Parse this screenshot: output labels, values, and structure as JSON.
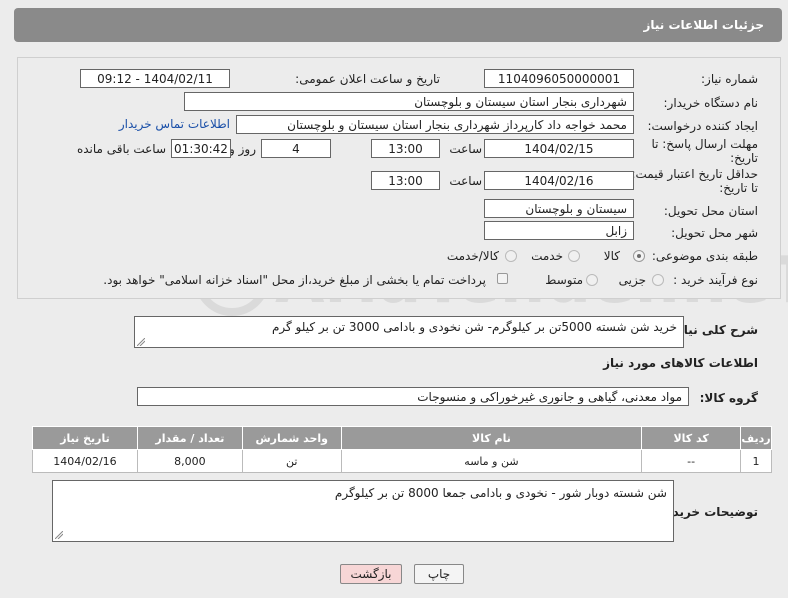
{
  "header": {
    "title": "جزئیات اطلاعات نیاز"
  },
  "form": {
    "need_number_label": "شماره نیاز:",
    "need_number": "1104096050000001",
    "announce_label": "تاریخ و ساعت اعلان عمومی:",
    "announce_value": "1404/02/11 - 09:12",
    "buyer_org_label": "نام دستگاه خریدار:",
    "buyer_org": "شهرداری بنجار استان سیستان و بلوچستان",
    "requester_label": "ایجاد کننده درخواست:",
    "requester": "محمد خواجه داد کارپرداز شهرداری بنجار استان سیستان و بلوچستان",
    "buyer_contact_link": "اطلاعات تماس خریدار",
    "deadline_label_1": "مهلت ارسال پاسخ: تا",
    "deadline_label_2": "تاریخ:",
    "deadline_date": "1404/02/15",
    "time_label": "ساعت",
    "deadline_time": "13:00",
    "days_value": "4",
    "days_label": "روز و",
    "remaining_value": "01:30:42",
    "remaining_label": "ساعت باقی مانده",
    "validity_label_1": "حداقل تاریخ اعتبار قیمت:",
    "validity_label_2": "تا تاریخ:",
    "validity_date": "1404/02/16",
    "validity_time": "13:00",
    "province_label": "استان محل تحویل:",
    "province": "سیستان و بلوچستان",
    "city_label": "شهر محل تحویل:",
    "city": "زابل",
    "category_label": "طبقه بندی موضوعی:",
    "category_options": [
      "کالا",
      "خدمت",
      "کالا/خدمت"
    ],
    "process_label": "نوع فرآیند خرید :",
    "process_options": [
      "جزیی",
      "متوسط"
    ],
    "payment_note": "پرداخت تمام یا بخشی از مبلغ خرید،از محل \"اسناد خزانه اسلامی\" خواهد بود."
  },
  "description": {
    "label": "شرح کلی نیاز:",
    "text": "خرید شن شسته 5000تن بر کیلوگرم- شن نخودی و بادامی 3000 تن بر کیلو گرم"
  },
  "goods": {
    "section_title": "اطلاعات کالاهای مورد نیاز",
    "group_label": "گروه کالا:",
    "group_value": "مواد معدنی، گیاهی و جانوری غیرخوراکی و منسوجات",
    "columns": [
      "ردیف",
      "کد کالا",
      "نام کالا",
      "واحد شمارش",
      "تعداد / مقدار",
      "تاریخ نیاز"
    ],
    "rows": [
      {
        "row": "1",
        "code": "--",
        "name": "شن و ماسه",
        "unit": "تن",
        "qty": "8,000",
        "date": "1404/02/16"
      }
    ]
  },
  "buyer_notes": {
    "label": "توضیحات خریدار:",
    "text": "شن شسته دوبار شور - نخودی و بادامی جمعا 8000 تن بر کیلوگرم"
  },
  "buttons": {
    "print": "چاپ",
    "back": "بازگشت"
  },
  "watermark": {
    "text": "AriaTender.neT"
  },
  "colors": {
    "header_bg": "#8a8a8a",
    "table_header_bg": "#9a9a9a",
    "link": "#1a4fa8",
    "back_button_bg": "#f7d6d6"
  }
}
